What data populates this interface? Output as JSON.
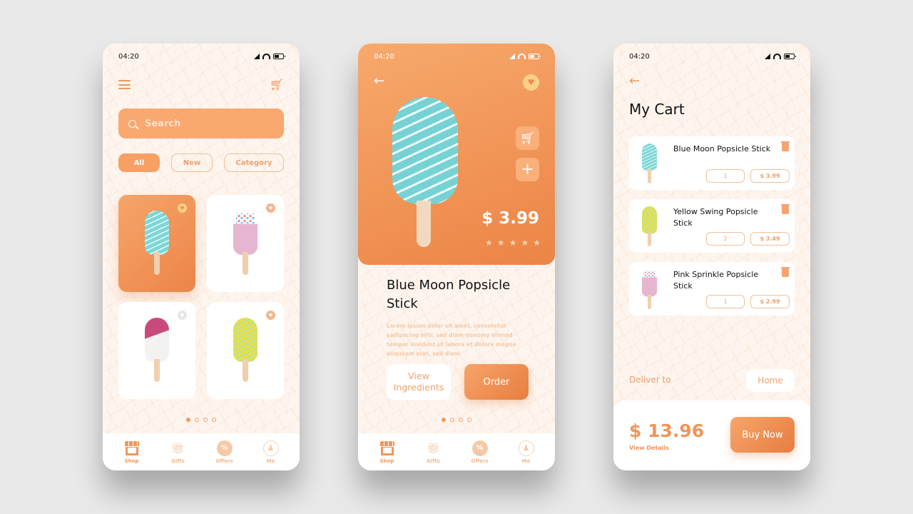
{
  "status_time": "04:20",
  "shop": {
    "search": {
      "placeholder": "Search",
      "value": ""
    },
    "filters": [
      {
        "label": "All",
        "active": true
      },
      {
        "label": "New",
        "active": false
      },
      {
        "label": "Category",
        "active": false
      }
    ],
    "products": [
      {
        "flavor": "blue",
        "favorited": true,
        "selected": true
      },
      {
        "flavor": "pink",
        "favorited": true,
        "selected": false
      },
      {
        "flavor": "white",
        "favorited": false,
        "selected": false
      },
      {
        "flavor": "yellow",
        "favorited": true,
        "selected": false
      }
    ],
    "page_dots": {
      "total": 4,
      "current": 1
    }
  },
  "tabbar": {
    "items": [
      {
        "label": "Shop",
        "icon": "shop-icon",
        "active": true
      },
      {
        "label": "Gifts",
        "icon": "gift-icon",
        "active": false
      },
      {
        "label": "Offers",
        "icon": "offers-icon",
        "active": false
      },
      {
        "label": "Me",
        "icon": "user-icon",
        "active": false
      }
    ]
  },
  "detail": {
    "price": "$ 3.99",
    "rating_stars": 5,
    "title": "Blue Moon Popsicle Stick",
    "description": "Lorem ipsum dolor sit amet, consetetur sadipscing elitr, sed diam nonumy eirmod tempor invidunt ut labore et dolore magna aliquyam erat, sed diam",
    "view_ingredients_label": "View Ingredients",
    "order_label": "Order",
    "page_dots": {
      "total": 4,
      "current": 1
    }
  },
  "cart": {
    "title": "My Cart",
    "items": [
      {
        "name": "Blue Moon Popsicle Stick",
        "qty": "1",
        "price": "$ 3.99",
        "flavor": "blue"
      },
      {
        "name": "Yellow Swing Popsicle Stick",
        "qty": "2",
        "price": "$ 3.49",
        "flavor": "yellow"
      },
      {
        "name": "Pink Sprinkle Popsicle Stick",
        "qty": "1",
        "price": "$ 2.99",
        "flavor": "pink"
      }
    ],
    "deliver_label": "Deliver to",
    "deliver_value": "Home",
    "total": "$ 13.96",
    "view_details_label": "View Details",
    "buy_label": "Buy Now"
  },
  "colors": {
    "accent": "#f0975c",
    "accent_dark": "#e87d40",
    "background": "#fdf5ee",
    "card_bg": "#ffffff"
  }
}
